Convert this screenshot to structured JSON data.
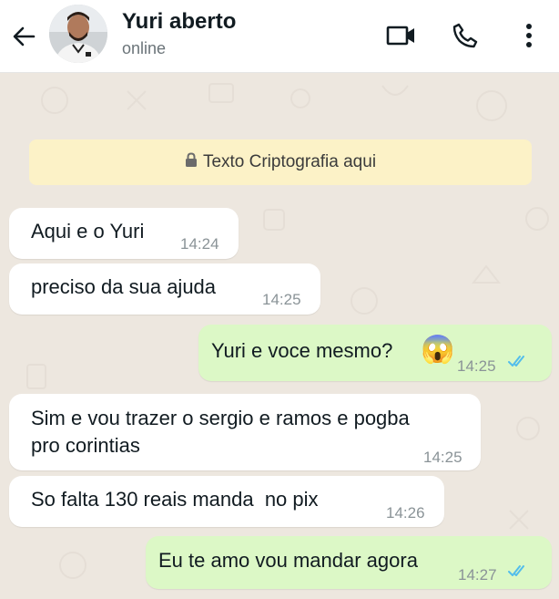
{
  "header": {
    "back_icon": "arrow-left-icon",
    "contact_name": "Yuri aberto",
    "status": "online",
    "video_icon": "video-camera-icon",
    "call_icon": "phone-icon",
    "menu_icon": "more-vertical-icon"
  },
  "encryption_notice": {
    "icon": "lock-icon",
    "text": "Texto Criptografia aqui"
  },
  "messages": [
    {
      "direction": "incoming",
      "lines": [
        "Aqui e o Yuri"
      ],
      "time": "14:24"
    },
    {
      "direction": "incoming",
      "lines": [
        "preciso da sua ajuda"
      ],
      "time": "14:25"
    },
    {
      "direction": "outgoing",
      "lines": [
        "Yuri e voce mesmo?"
      ],
      "emoji": "😱",
      "time": "14:25",
      "read": true
    },
    {
      "direction": "incoming",
      "lines": [
        "Sim e vou trazer o sergio e ramos e pogba",
        "pro corintias"
      ],
      "time": "14:25"
    },
    {
      "direction": "incoming",
      "lines": [
        "So falta 130 reais manda  no pix"
      ],
      "time": "14:26"
    },
    {
      "direction": "outgoing",
      "lines": [
        "Eu te amo vou mandar agora"
      ],
      "time": "14:27",
      "read": true
    }
  ],
  "colors": {
    "chat_background": "#ede7df",
    "incoming_bubble": "#ffffff",
    "outgoing_bubble": "#dcf8c6",
    "notice_background": "#fcf2c7",
    "read_ticks": "#53bdeb"
  }
}
